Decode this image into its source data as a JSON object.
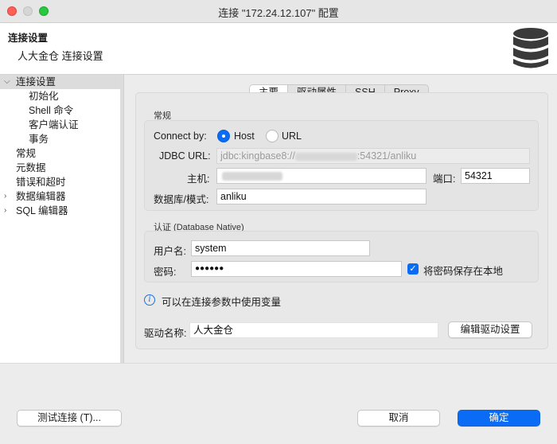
{
  "window": {
    "title": "连接 \"172.24.12.107\" 配置"
  },
  "header": {
    "title": "连接设置",
    "subtitle": "人大金仓 连接设置",
    "icon": "database-icon"
  },
  "sidebar": {
    "items": [
      {
        "label": "连接设置",
        "expanded": true,
        "selected": true
      },
      {
        "label": "初始化"
      },
      {
        "label": "Shell 命令"
      },
      {
        "label": "客户端认证"
      },
      {
        "label": "事务"
      },
      {
        "label": "常规"
      },
      {
        "label": "元数据"
      },
      {
        "label": "错误和超时"
      },
      {
        "label": "数据编辑器",
        "expandable": true
      },
      {
        "label": "SQL 编辑器",
        "expandable": true
      }
    ]
  },
  "tabs": [
    "主要",
    "驱动属性",
    "SSH",
    "Proxy"
  ],
  "general": {
    "group_label": "常规",
    "connect_by_label": "Connect by:",
    "host_option": "Host",
    "url_option": "URL",
    "selected": "Host",
    "jdbc_label": "JDBC URL:",
    "jdbc_prefix": "jdbc:kingbase8://",
    "jdbc_suffix": ":54321/anliku",
    "host_label": "主机:",
    "port_label": "端口:",
    "port_value": "54321",
    "db_label": "数据库/模式:",
    "db_value": "anliku"
  },
  "auth": {
    "group_label": "认证 (Database Native)",
    "user_label": "用户名:",
    "user_value": "system",
    "password_label": "密码:",
    "password_value": "●●●●●●",
    "save_password_label": "将密码保存在本地",
    "save_password_checked": true
  },
  "info": {
    "text": "可以在连接参数中使用变量"
  },
  "driver": {
    "label": "驱动名称:",
    "value": "人大金仓",
    "edit_button": "编辑驱动设置"
  },
  "footer": {
    "test_button": "测试连接 (T)...",
    "cancel_button": "取消",
    "ok_button": "确定"
  },
  "colors": {
    "accent": "#0a6cf5",
    "close": "#ff5f57",
    "maximize": "#28c840"
  }
}
